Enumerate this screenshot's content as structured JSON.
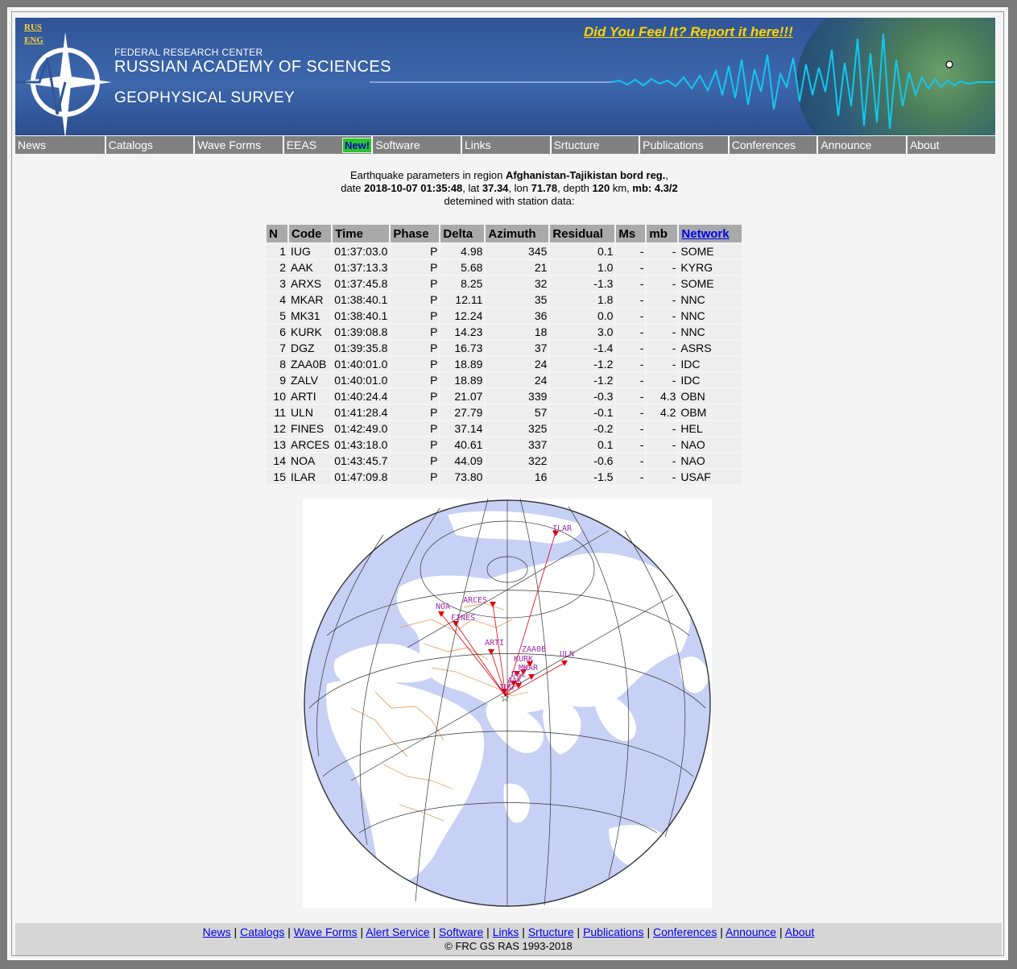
{
  "header": {
    "lang_rus": "RUS",
    "lang_eng": "ENG",
    "org_line1": "FEDERAL RESEARCH CENTER",
    "org_line2": "RUSSIAN ACADEMY OF SCIENCES",
    "org_line3": "GEOPHYSICAL SURVEY",
    "report_link": "Did You Feel It? Report it here!!!"
  },
  "menu": {
    "items": [
      "News",
      "Catalogs",
      "Wave Forms",
      "EEAS",
      "Software",
      "Links",
      "Srtucture",
      "Publications",
      "Conferences",
      "Announce",
      "About"
    ],
    "new_badge": "New!"
  },
  "intro": {
    "line1_prefix": "Earthquake parameters in region ",
    "region": "Afghanistan-Tajikistan bord reg.",
    "line1_suffix": ",",
    "date_label": "date ",
    "datetime": "2018-10-07 01:35:48",
    "lat_label": ", lat ",
    "lat": "37.34",
    "lon_label": ", lon ",
    "lon": "71.78",
    "depth_label": ", depth ",
    "depth": "120",
    "depth_unit": " km, ",
    "mb_label": "mb: 4.3/2",
    "line3": "detemined with station data:"
  },
  "table": {
    "headers": [
      "N",
      "Code",
      "Time",
      "Phase",
      "Delta",
      "Azimuth",
      "Residual",
      "Ms",
      "mb",
      "Network"
    ],
    "rows": [
      [
        "1",
        "IUG",
        "01:37:03.0",
        "P",
        "4.98",
        "345",
        "0.1",
        "-",
        "-",
        "SOME"
      ],
      [
        "2",
        "AAK",
        "01:37:13.3",
        "P",
        "5.68",
        "21",
        "1.0",
        "-",
        "-",
        "KYRG"
      ],
      [
        "3",
        "ARXS",
        "01:37:45.8",
        "P",
        "8.25",
        "32",
        "-1.3",
        "-",
        "-",
        "SOME"
      ],
      [
        "4",
        "MKAR",
        "01:38:40.1",
        "P",
        "12.11",
        "35",
        "1.8",
        "-",
        "-",
        "NNC"
      ],
      [
        "5",
        "MK31",
        "01:38:40.1",
        "P",
        "12.24",
        "36",
        "0.0",
        "-",
        "-",
        "NNC"
      ],
      [
        "6",
        "KURK",
        "01:39:08.8",
        "P",
        "14.23",
        "18",
        "3.0",
        "-",
        "-",
        "NNC"
      ],
      [
        "7",
        "DGZ",
        "01:39:35.8",
        "P",
        "16.73",
        "37",
        "-1.4",
        "-",
        "-",
        "ASRS"
      ],
      [
        "8",
        "ZAA0B",
        "01:40:01.0",
        "P",
        "18.89",
        "24",
        "-1.2",
        "-",
        "-",
        "IDC"
      ],
      [
        "9",
        "ZALV",
        "01:40:01.0",
        "P",
        "18.89",
        "24",
        "-1.2",
        "-",
        "-",
        "IDC"
      ],
      [
        "10",
        "ARTI",
        "01:40:24.4",
        "P",
        "21.07",
        "339",
        "-0.3",
        "-",
        "4.3",
        "OBN"
      ],
      [
        "11",
        "ULN",
        "01:41:28.4",
        "P",
        "27.79",
        "57",
        "-0.1",
        "-",
        "4.2",
        "OBM"
      ],
      [
        "12",
        "FINES",
        "01:42:49.0",
        "P",
        "37.14",
        "325",
        "-0.2",
        "-",
        "-",
        "HEL"
      ],
      [
        "13",
        "ARCES",
        "01:43:18.0",
        "P",
        "40.61",
        "337",
        "0.1",
        "-",
        "-",
        "NAO"
      ],
      [
        "14",
        "NOA",
        "01:43:45.7",
        "P",
        "44.09",
        "322",
        "-0.6",
        "-",
        "-",
        "NAO"
      ],
      [
        "15",
        "ILAR",
        "01:47:09.8",
        "P",
        "73.80",
        "16",
        "-1.5",
        "-",
        "-",
        "USAF"
      ]
    ]
  },
  "map": {
    "labels": [
      "ILAR",
      "ARCES",
      "NOA",
      "FINES",
      "ARTI",
      "ZAA0B",
      "ULN",
      "KURK",
      "MKAR",
      "DGZ",
      "AAK",
      "IUG"
    ],
    "ocean_color": "#c7d0f5",
    "land_color": "#ffffff",
    "border_color": "#e8a26b",
    "ray_color": "#e0000a",
    "station_label_color": "#9b2aa3"
  },
  "footer": {
    "links": [
      "News",
      "Catalogs",
      "Wave Forms",
      "Alert Service",
      "Software",
      "Links",
      "Srtucture",
      "Publications",
      "Conferences",
      "Announce",
      "About"
    ],
    "copyright": "© FRC GS RAS 1993-2018"
  }
}
